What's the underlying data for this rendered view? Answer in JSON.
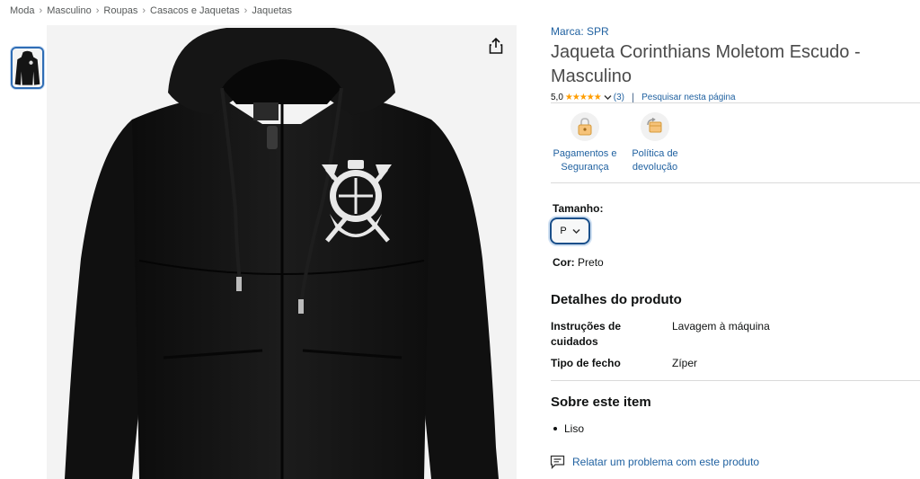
{
  "breadcrumb": [
    "Moda",
    "Masculino",
    "Roupas",
    "Casacos e Jaquetas",
    "Jaquetas"
  ],
  "breadcrumb_separator": "›",
  "product": {
    "brand": "Marca: SPR",
    "title": "Jaqueta Corinthians Moletom Escudo - Masculino",
    "rating_value": "5,0",
    "stars": "★★★★★",
    "rating_count": "(3)",
    "rating_separator": "|",
    "search_page_link": "Pesquisar nesta página"
  },
  "features": [
    {
      "label_line1": "Pagamentos e",
      "label_line2": "Segurança",
      "icon": "lock-icon"
    },
    {
      "label_line1": "Política de",
      "label_line2": "devolução",
      "icon": "return-icon"
    }
  ],
  "size": {
    "label": "Tamanho:",
    "selected": "P"
  },
  "color": {
    "label": "Cor:",
    "value": "Preto"
  },
  "details": {
    "heading": "Detalhes do produto",
    "rows": [
      {
        "key_line1": "Instruções de",
        "key_line2": "cuidados",
        "value": "Lavagem à máquina"
      },
      {
        "key_line1": "Tipo de fecho",
        "key_line2": "",
        "value": "Zíper"
      }
    ]
  },
  "about": {
    "heading": "Sobre este item",
    "bullets": [
      "Liso"
    ]
  },
  "report_link": "Relatar um problema com este produto",
  "colors": {
    "link": "#2162a1",
    "star": "#ff9d00",
    "thumb_border": "#2f6db5",
    "jacket": "#141414"
  }
}
